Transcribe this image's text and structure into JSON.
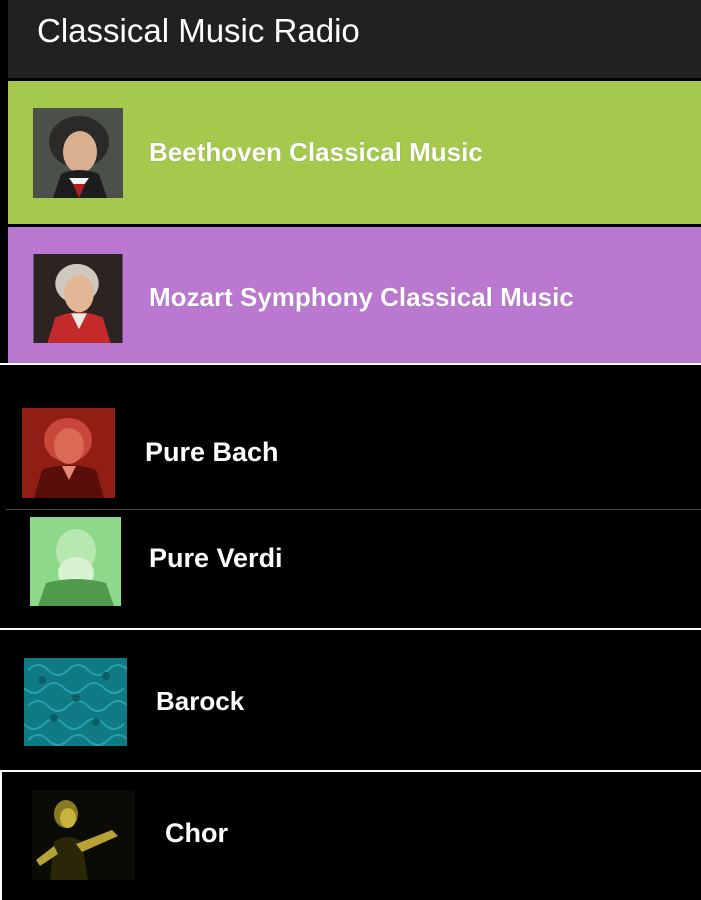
{
  "app": {
    "title": "Classical Music Radio"
  },
  "stations": [
    {
      "label": "Beethoven Classical Music",
      "bg": "#a4c94c",
      "icon": "beethoven-portrait-icon"
    },
    {
      "label": "Mozart Symphony Classical Music",
      "bg": "#ba78d0",
      "icon": "mozart-portrait-icon"
    },
    {
      "label": "Pure Bach",
      "bg": "#000000",
      "icon": "bach-portrait-icon"
    },
    {
      "label": "Pure Verdi",
      "bg": "#000000",
      "icon": "verdi-portrait-icon"
    },
    {
      "label": "Barock",
      "bg": "#000000",
      "icon": "barock-pattern-icon"
    },
    {
      "label": "Chor",
      "bg": "#000000",
      "icon": "choir-singer-icon"
    }
  ]
}
